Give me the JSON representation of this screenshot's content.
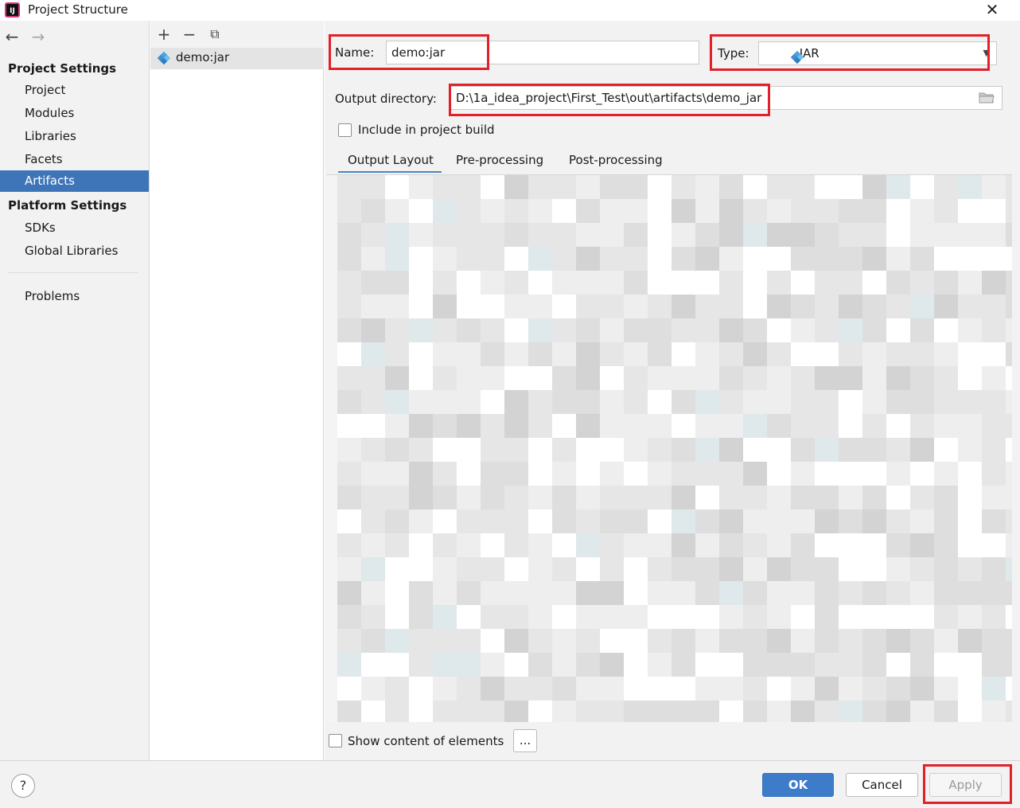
{
  "window": {
    "title": "Project Structure",
    "app_icon_text": "IJ"
  },
  "sidebar": {
    "project_settings_title": "Project Settings",
    "project_settings_items": [
      "Project",
      "Modules",
      "Libraries",
      "Facets",
      "Artifacts"
    ],
    "selected_item": "Artifacts",
    "platform_settings_title": "Platform Settings",
    "platform_settings_items": [
      "SDKs",
      "Global Libraries"
    ],
    "problems_label": "Problems"
  },
  "artifacts_list": {
    "items": [
      "demo:jar"
    ]
  },
  "config": {
    "name_label": "Name:",
    "name_value": "demo:jar",
    "type_label": "Type:",
    "type_value": "JAR",
    "output_dir_label": "Output directory:",
    "output_dir_value": "D:\\1a_idea_project\\First_Test\\out\\artifacts\\demo_jar",
    "include_build_label": "Include in project build",
    "include_build_checked": false,
    "tabs": [
      "Output Layout",
      "Pre-processing",
      "Post-processing"
    ],
    "active_tab": "Output Layout",
    "show_content_label": "Show content of elements",
    "show_content_checked": false,
    "ellipsis_button": "..."
  },
  "buttons": {
    "ok": "OK",
    "cancel": "Cancel",
    "apply": "Apply",
    "help": "?"
  },
  "colors": {
    "selection": "#3e75b9",
    "ok_button": "#3e7cc9",
    "annotation_red": "#e2202a",
    "tab_underline": "#4a86c7"
  }
}
